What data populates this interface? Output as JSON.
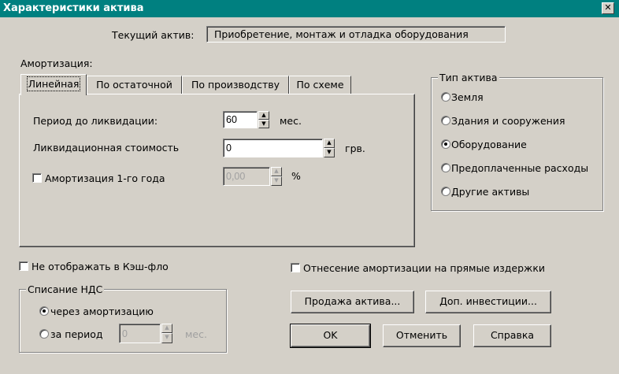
{
  "window": {
    "title": "Характеристики актива",
    "close_glyph": "✕"
  },
  "current_asset": {
    "label": "Текущий актив:",
    "value": "Приобретение, монтаж и отладка оборудования"
  },
  "amortization": {
    "label": "Амортизация:",
    "tabs": [
      {
        "label": "Линейная",
        "active": true
      },
      {
        "label": "По остаточной",
        "active": false
      },
      {
        "label": "По производству",
        "active": false
      },
      {
        "label": "По схеме",
        "active": false
      }
    ],
    "period_label": "Период до ликвидации:",
    "period_value": "60",
    "period_unit": "мес.",
    "liquidation_label": "Ликвидационная стоимость",
    "liquidation_value": "0",
    "liquidation_unit": "грв.",
    "first_year_label": "Амортизация 1-го года",
    "first_year_checked": false,
    "first_year_value": "0,00",
    "first_year_unit": "%"
  },
  "asset_type": {
    "label": "Тип актива",
    "options": [
      {
        "label": "Земля",
        "selected": false
      },
      {
        "label": "Здания и сооружения",
        "selected": false
      },
      {
        "label": "Оборудование",
        "selected": true
      },
      {
        "label": "Предоплаченные расходы",
        "selected": false
      },
      {
        "label": "Другие активы",
        "selected": false
      }
    ]
  },
  "hide_cashflow": {
    "label": "Не отображать в Кэш-фло",
    "checked": false
  },
  "direct_costs": {
    "label": "Отнесение амортизации на прямые издержки",
    "checked": false
  },
  "vat": {
    "label": "Списание НДС",
    "option_through": "через амортизацию",
    "option_period": "за период",
    "selected": "through",
    "period_value": "0",
    "period_unit": "мес."
  },
  "buttons": {
    "sell": "Продажа актива...",
    "invest": "Доп. инвестиции...",
    "ok": "OK",
    "cancel": "Отменить",
    "help": "Справка"
  },
  "spin_up_glyph": "▲",
  "spin_down_glyph": "▼"
}
